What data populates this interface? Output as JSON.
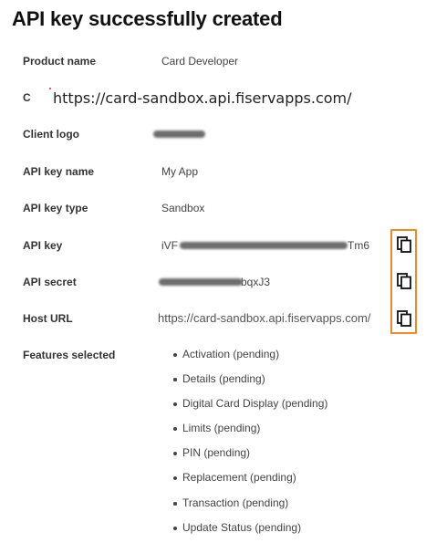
{
  "page": {
    "title": "API key successfully created"
  },
  "overlay": {
    "url": "https://card-sandbox.api.fiservapps.com/",
    "hidden_label": "C"
  },
  "details": {
    "product_name_label": "Product name",
    "product_name_value": "Card Developer",
    "client_logo_label": "Client logo",
    "api_key_name_label": "API key name",
    "api_key_name_value": "My App",
    "api_key_type_label": "API key type",
    "api_key_type_value": "Sandbox",
    "api_key_label": "API key",
    "api_key_prefix": "iVF",
    "api_key_suffix": "Tm6",
    "api_secret_label": "API secret",
    "api_secret_suffix": "bqxJ3",
    "host_url_label": "Host URL",
    "host_url_value": "https://card-sandbox.api.fiservapps.com/",
    "features_label": "Features selected",
    "features": [
      "Activation (pending)",
      "Details (pending)",
      "Digital Card Display (pending)",
      "Limits (pending)",
      "PIN (pending)",
      "Replacement (pending)",
      "Transaction (pending)",
      "Update Status (pending)"
    ]
  },
  "icons": {
    "copy": "copy-icon"
  },
  "colors": {
    "highlight": "#f08a24",
    "text": "#333333",
    "redacted": "#6d6d6d"
  }
}
